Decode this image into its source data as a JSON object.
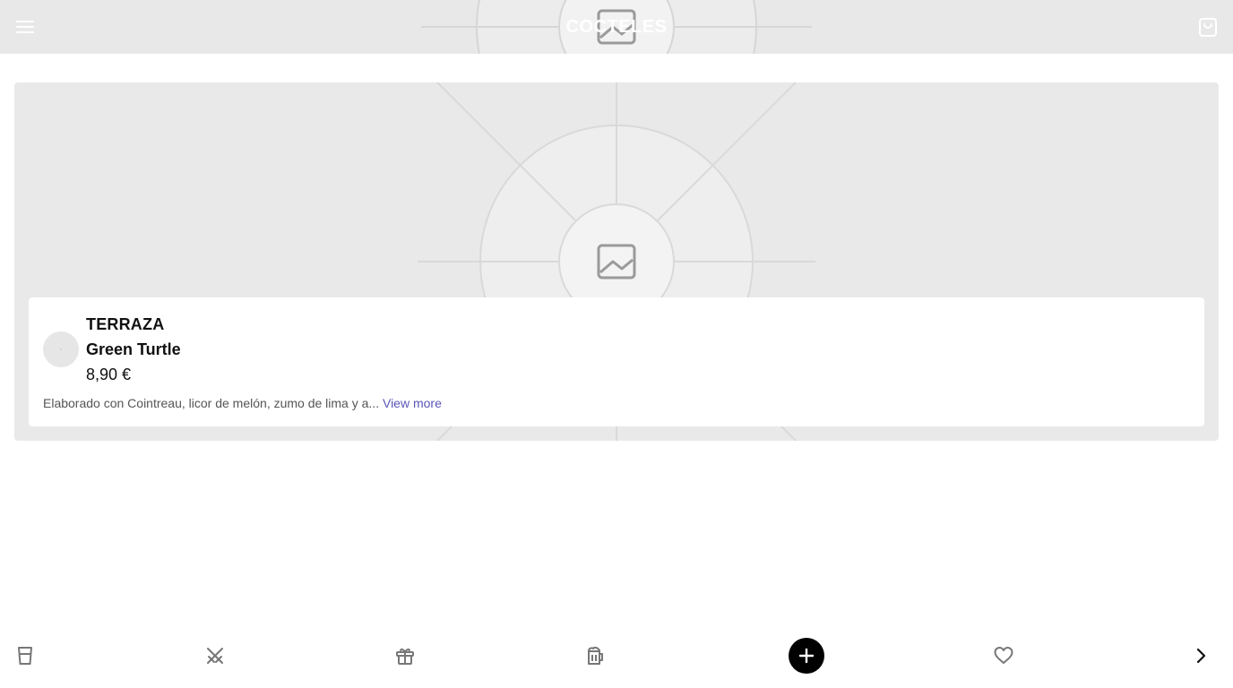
{
  "header": {
    "title": "COCTELES",
    "menu_icon": "menu-icon",
    "cart_icon": "shopping-bag-icon"
  },
  "product": {
    "image_placeholder_icon": "image-placeholder-icon",
    "category": "TERRAZA",
    "name": "Green Turtle",
    "price": "8,90 €",
    "description": "Elaborado con Cointreau, licor de melón, zumo de lima y a...",
    "view_more_label": "View more"
  },
  "bottom_nav": {
    "items": [
      {
        "icon": "glass-icon"
      },
      {
        "icon": "crossed-swords-icon"
      },
      {
        "icon": "gift-icon"
      },
      {
        "icon": "beer-mug-icon"
      },
      {
        "icon": "plus-icon"
      },
      {
        "icon": "heart-icon"
      },
      {
        "icon": "chevron-right-icon"
      }
    ]
  },
  "colors": {
    "header_bg": "#e8e8e8",
    "card_bg": "#e9e9e9",
    "link": "#5a55b8",
    "fab_bg": "#000000"
  }
}
